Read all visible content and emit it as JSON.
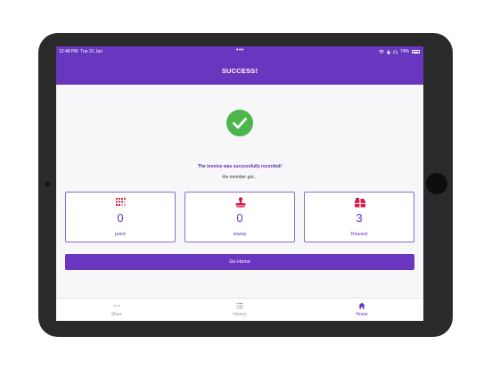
{
  "status_bar": {
    "time": "12:48 PM",
    "date": "Tue 31 Jan",
    "center_dots": "•••",
    "battery": "74%",
    "battery_level": 0.74
  },
  "header": {
    "title": "SUCCESS!"
  },
  "messages": {
    "success": "The invoice was successfully recorded!",
    "sub": "the member got..."
  },
  "cards": [
    {
      "value": "0",
      "label": "point",
      "icon": "dots-grid-icon"
    },
    {
      "value": "0",
      "label": "stamp",
      "icon": "stamp-icon"
    },
    {
      "value": "3",
      "label": "Reward",
      "icon": "gift-icon"
    }
  ],
  "go_home_label": "Go Home",
  "tabs": [
    {
      "label": "More",
      "icon": "more-dots-icon",
      "active": false
    },
    {
      "label": "History",
      "icon": "list-icon",
      "active": false
    },
    {
      "label": "Home",
      "icon": "home-icon",
      "active": true
    }
  ],
  "colors": {
    "brand": "#6936c0",
    "success": "#4cb64c",
    "icon_red": "#d51a45",
    "inactive": "#9a9a9a"
  }
}
